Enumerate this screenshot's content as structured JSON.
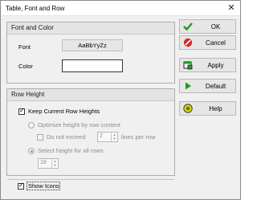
{
  "window": {
    "title": "Table, Font and Row",
    "close_glyph": "✕"
  },
  "font_color": {
    "heading": "Font and Color",
    "font_label": "Font",
    "font_sample": "AaBbYyZz",
    "color_label": "Color",
    "color_value": "#ffffff"
  },
  "row_height": {
    "heading": "Row Height",
    "keep_current": {
      "label": "Keep Current Row Heights",
      "checked": true
    },
    "optimize": {
      "label": "Optimize height by row content",
      "selected": false
    },
    "do_not_exceed": {
      "label": "Do not exceed",
      "checked": false
    },
    "lines_value": "2",
    "lines_suffix": "lines per row",
    "select_height": {
      "label": "Select height for all rows",
      "selected": true
    },
    "height_value": "18"
  },
  "show_icons": {
    "label": "Show Icons",
    "checked": true
  },
  "buttons": [
    {
      "label": "OK",
      "icon": "check-icon",
      "color": "#1e9c1e"
    },
    {
      "label": "Cancel",
      "icon": "cancel-icon",
      "color": "#d42a2a"
    },
    {
      "label": "Apply",
      "icon": "apply-icon",
      "color": "#1e9c1e"
    },
    {
      "label": "Default",
      "icon": "play-icon",
      "color": "#1e9c1e"
    },
    {
      "label": "Help",
      "icon": "help-icon",
      "color": "#c9b400"
    }
  ]
}
